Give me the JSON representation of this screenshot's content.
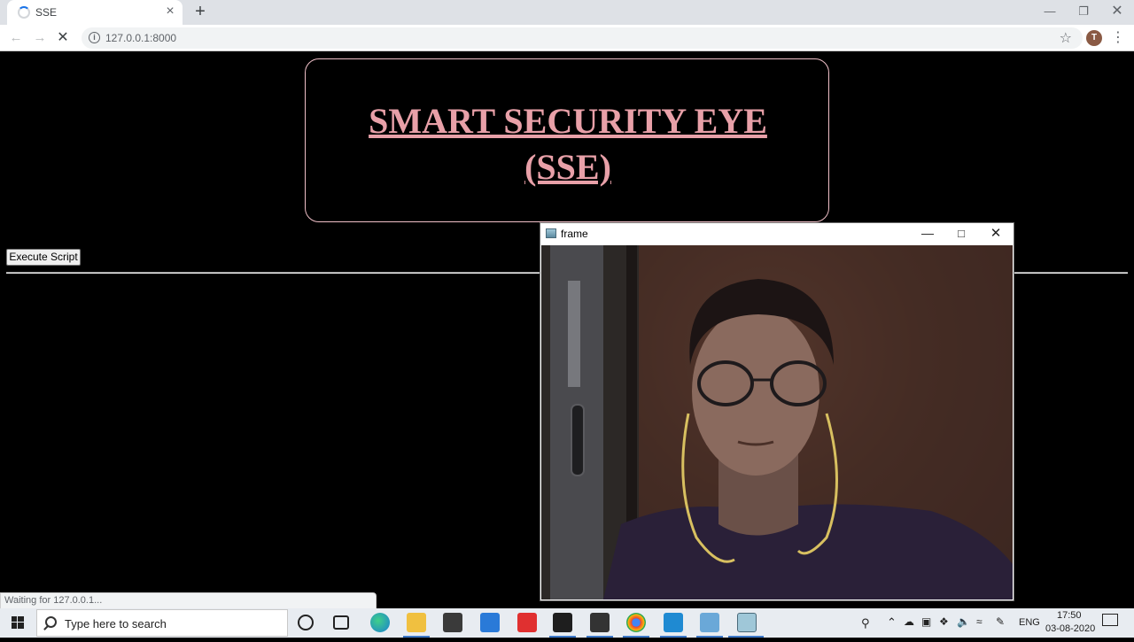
{
  "browser": {
    "tab_title": "SSE",
    "tab_close": "×",
    "new_tab": "+",
    "url": "127.0.0.1:8000",
    "status": "Waiting for 127.0.0.1...",
    "avatar_initial": "T",
    "icons": [
      "back-arrow-icon",
      "forward-arrow-icon",
      "stop-loading-icon",
      "site-info-icon",
      "star-icon",
      "kebab-menu-icon"
    ]
  },
  "page": {
    "title": "SMART SECURITY EYE (SSE)",
    "execute_button": "Execute Script"
  },
  "cv_window": {
    "title": "frame"
  },
  "taskbar": {
    "search_placeholder": "Type here to search",
    "language": "ENG",
    "time": "17:50",
    "date": "03-08-2020",
    "colors": {
      "accent_underline": "#3c78c8",
      "title_pink": "#e8a0a8"
    }
  }
}
